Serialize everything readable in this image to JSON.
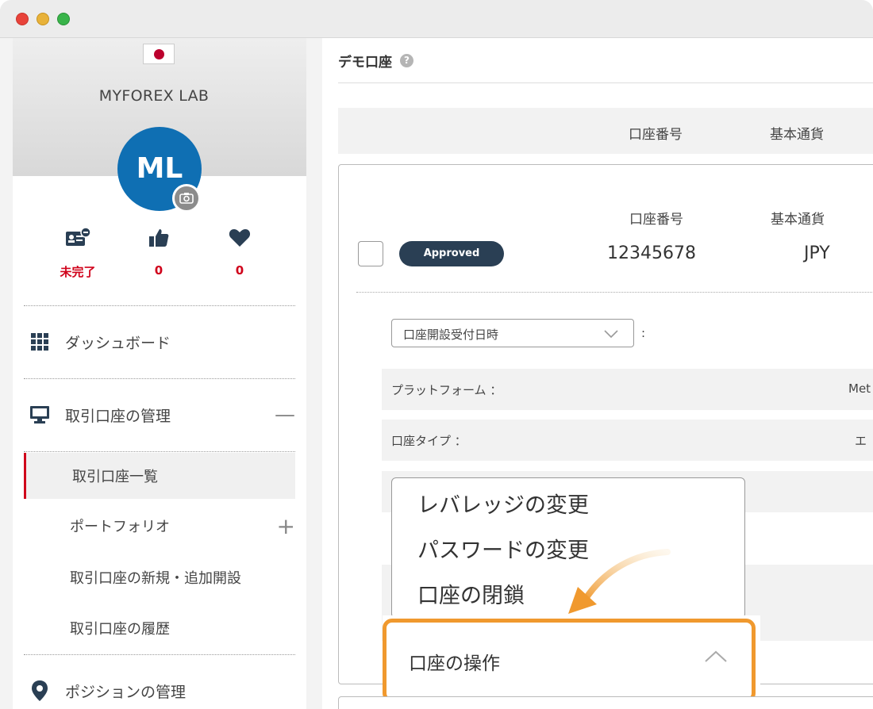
{
  "profile": {
    "name": "MYFOREX LAB",
    "initials": "ML"
  },
  "stats": [
    {
      "icon": "id-card-icon",
      "value": "未完了"
    },
    {
      "icon": "thumbs-up-icon",
      "value": "0"
    },
    {
      "icon": "heart-icon",
      "value": "0"
    }
  ],
  "nav": {
    "dashboard": "ダッシュボード",
    "account_management": "取引口座の管理",
    "account_management_toggle": "—",
    "sub_items": [
      {
        "label": "取引口座一覧",
        "active": true
      },
      {
        "label": "ポートフォリオ",
        "toggle": "+"
      },
      {
        "label": "取引口座の新規・追加開設"
      },
      {
        "label": "取引口座の履歴"
      }
    ],
    "positions": "ポジションの管理"
  },
  "main": {
    "title": "デモ口座",
    "header_columns": [
      "口座番号",
      "基本通貨"
    ],
    "account": {
      "status": "Approved",
      "col_account_no": "口座番号",
      "col_currency": "基本通貨",
      "account_no": "12345678",
      "currency": "JPY"
    },
    "date_select": "口座開設受付日時",
    "colon": ":",
    "rows": [
      {
        "label": "プラットフォーム ：",
        "value": "Met"
      },
      {
        "label": "口座タイプ ：",
        "value": "エ"
      }
    ],
    "dropdown": [
      "レバレッジの変更",
      "パスワードの変更",
      "口座の閉鎖"
    ],
    "operation_label": "口座の操作"
  },
  "colors": {
    "accent_red": "#d0021b",
    "badge_bg": "#2a3f54",
    "avatar_bg": "#0f6fb3",
    "highlight_orange": "#f0992e"
  }
}
